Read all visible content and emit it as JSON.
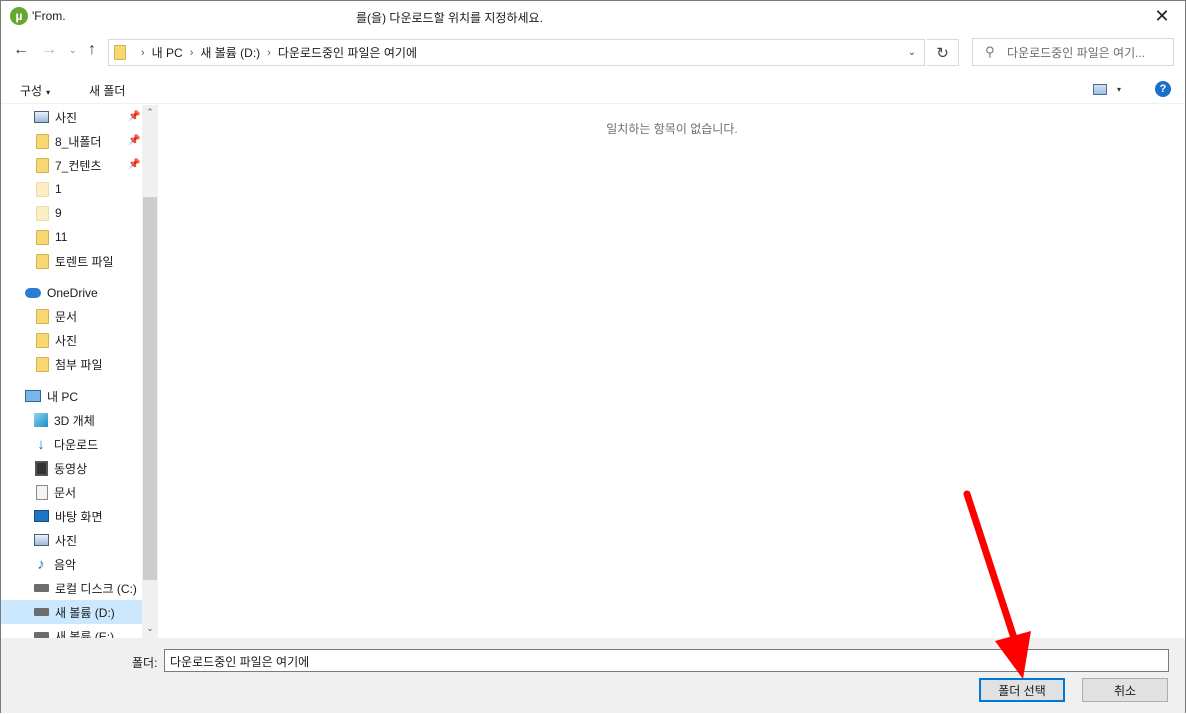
{
  "titlebar": {
    "app_icon": "utorrent-icon",
    "left_text": "'From.",
    "center_text": "를(을) 다운로드할 위치를 지정하세요.",
    "close_glyph": "✕"
  },
  "nav": {
    "back_glyph": "←",
    "forward_glyph": "→",
    "recent_glyph": "⌄",
    "up_glyph": "↑"
  },
  "address": {
    "crumbs": [
      "내 PC",
      "새 볼륨 (D:)",
      "다운로드중인 파일은 여기에"
    ],
    "separator": "›",
    "dropdown_glyph": "⌄",
    "refresh_glyph": "↻"
  },
  "search": {
    "placeholder": "다운로드중인 파일은 여기...",
    "icon_glyph": "⚲"
  },
  "toolbar": {
    "organize_label": "구성",
    "organize_caret": "▾",
    "new_folder_label": "새 폴더",
    "view_caret": "▾",
    "help_glyph": "?"
  },
  "sidebar": {
    "items": [
      {
        "label": "사진",
        "icon": "pictures-icon",
        "pinned": true
      },
      {
        "label": "8_내폴더",
        "icon": "folder-icon",
        "pinned": true
      },
      {
        "label": "7_컨텐츠",
        "icon": "folder-icon",
        "pinned": true
      },
      {
        "label": "1",
        "icon": "folder-light-icon",
        "pinned": false
      },
      {
        "label": "9",
        "icon": "folder-light-icon",
        "pinned": false
      },
      {
        "label": "11",
        "icon": "folder-icon",
        "pinned": false
      },
      {
        "label": "토렌트 파일",
        "icon": "folder-icon",
        "pinned": false
      },
      {
        "label": "OneDrive",
        "icon": "onedrive-icon",
        "pinned": false
      },
      {
        "label": "문서",
        "icon": "folder-icon",
        "pinned": false
      },
      {
        "label": "사진",
        "icon": "folder-icon",
        "pinned": false
      },
      {
        "label": "첨부 파일",
        "icon": "folder-icon",
        "pinned": false
      },
      {
        "label": "내 PC",
        "icon": "pc-icon",
        "pinned": false
      },
      {
        "label": "3D 개체",
        "icon": "3d-objects-icon",
        "pinned": false
      },
      {
        "label": "다운로드",
        "icon": "downloads-icon",
        "pinned": false
      },
      {
        "label": "동영상",
        "icon": "videos-icon",
        "pinned": false
      },
      {
        "label": "문서",
        "icon": "documents-icon",
        "pinned": false
      },
      {
        "label": "바탕 화면",
        "icon": "desktop-icon",
        "pinned": false
      },
      {
        "label": "사진",
        "icon": "pictures-icon",
        "pinned": false
      },
      {
        "label": "음악",
        "icon": "music-icon",
        "pinned": false
      },
      {
        "label": "로컬 디스크 (C:)",
        "icon": "drive-icon",
        "pinned": false
      },
      {
        "label": "새 볼륨 (D:)",
        "icon": "drive-icon",
        "pinned": false,
        "selected": true
      },
      {
        "label": "새 볼륨 (E:)",
        "icon": "drive-icon",
        "pinned": false
      }
    ],
    "pin_glyph": "📌",
    "scroll_up_glyph": "⌃",
    "scroll_down_glyph": "⌄"
  },
  "content": {
    "empty_message": "일치하는 항목이 없습니다."
  },
  "bottom": {
    "folder_label": "폴더:",
    "folder_value": "다운로드중인 파일은 여기에",
    "select_button": "폴더 선택",
    "cancel_button": "취소"
  },
  "annotation": {
    "arrow_color": "#ff0000"
  }
}
